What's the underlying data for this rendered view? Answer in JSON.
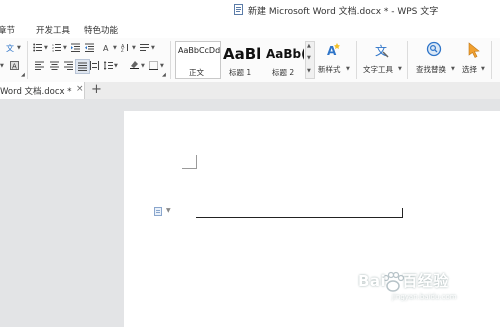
{
  "window": {
    "title": "新建 Microsoft Word 文档.docx * - WPS 文字"
  },
  "menu": {
    "tabs": [
      "章节",
      "开发工具",
      "特色功能"
    ]
  },
  "styles": {
    "items": [
      {
        "sample": "AaBbCcDd",
        "name": "正文"
      },
      {
        "sample": "AaBl",
        "name": "标题 1"
      },
      {
        "sample": "AaBb(",
        "name": "标题 2"
      }
    ]
  },
  "ribbon": {
    "new_style": "新样式",
    "text_tools": "文字工具",
    "find_replace": "查找替换",
    "select": "选择"
  },
  "tabs": {
    "document": "Word 文档.docx *",
    "close": "×",
    "new": "+"
  },
  "watermark": {
    "brand": "Bai",
    "brand_mark": "百",
    "brand_suffix": "经验",
    "url": "jingyan.baidu.com"
  },
  "colors": {
    "accent": "#2e74c8",
    "highlight": "#f3c12b",
    "fontcolor": "#d62020",
    "select_icon": "#f0a030"
  }
}
